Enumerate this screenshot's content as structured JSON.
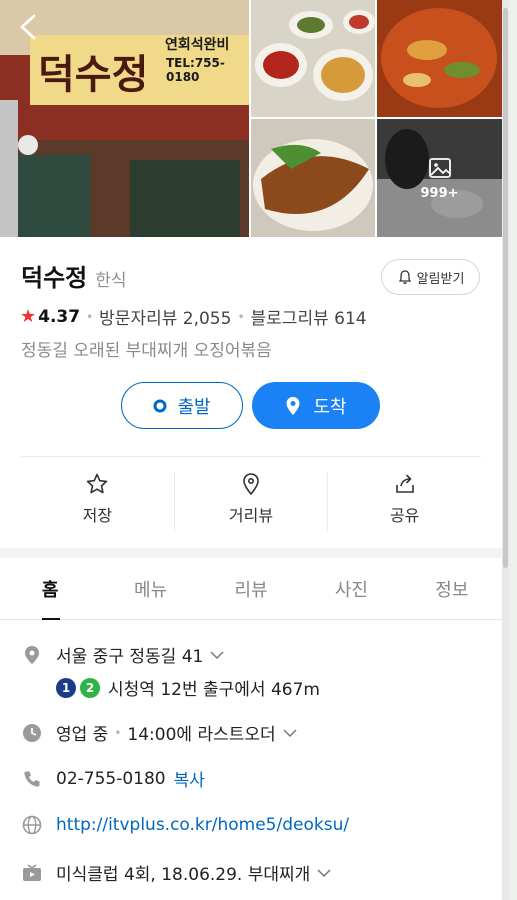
{
  "place": {
    "name": "덕수정",
    "category": "한식",
    "alarm_label": "알림받기",
    "rating": "4.37",
    "visitor_reviews": "방문자리뷰 2,055",
    "blog_reviews": "블로그리뷰 614",
    "description": "정동길 오래된 부대찌개 오징어볶음"
  },
  "photos": {
    "more_count": "999+",
    "sign_name": "덕수정",
    "sign_sub": "연회석완비",
    "sign_tel": "TEL:755-0180"
  },
  "route": {
    "depart_label": "출발",
    "arrive_label": "도착"
  },
  "actions": [
    {
      "label": "저장",
      "icon": "star-outline-icon"
    },
    {
      "label": "거리뷰",
      "icon": "location-pin-icon"
    },
    {
      "label": "공유",
      "icon": "share-icon"
    }
  ],
  "tabs": [
    {
      "label": "홈",
      "active": true
    },
    {
      "label": "메뉴",
      "active": false
    },
    {
      "label": "리뷰",
      "active": false
    },
    {
      "label": "사진",
      "active": false
    },
    {
      "label": "정보",
      "active": false
    }
  ],
  "info": {
    "address": "서울 중구 정동길 41",
    "subway_lines": [
      "1",
      "2"
    ],
    "subway_text": "시청역 12번 출구에서 467m",
    "hours_status": "영업 중",
    "hours_text": "14:00에 라스트오더",
    "phone": "02-755-0180",
    "copy_label": "복사",
    "website": "http://itvplus.co.kr/home5/deoksu/",
    "tv_info": "미식클럽 4회, 18.06.29. 부대찌개"
  },
  "colors": {
    "accent": "#1a82f5",
    "brand_blue": "#0068c3",
    "star": "#f22e2e",
    "line1": "#1e3a8a",
    "line2": "#2fb348"
  }
}
